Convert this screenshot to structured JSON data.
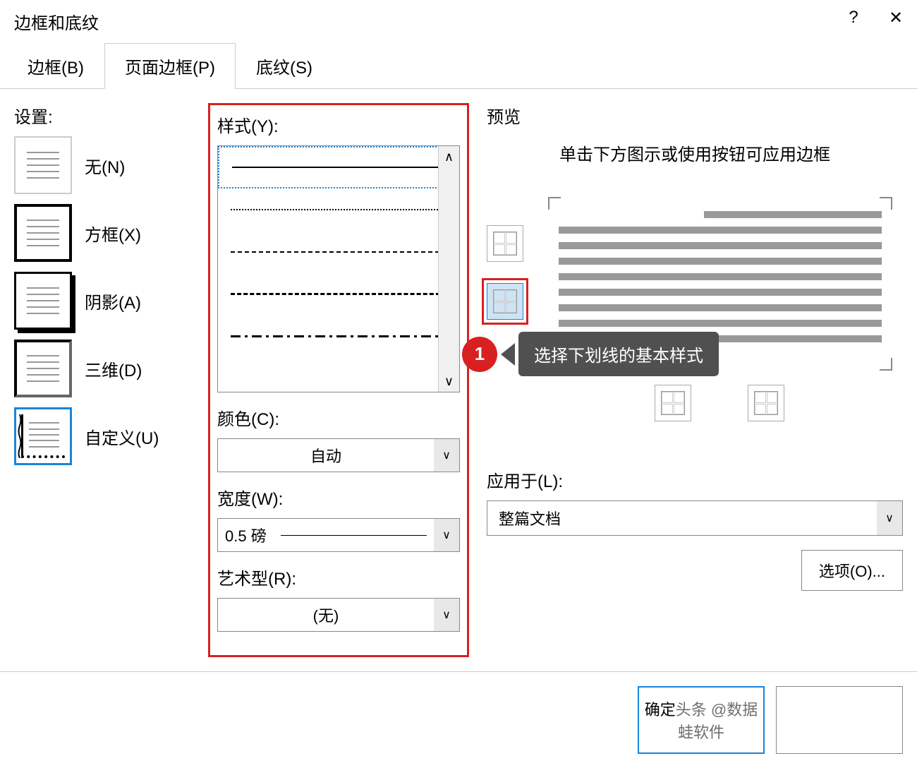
{
  "dialog": {
    "title": "边框和底纹",
    "help": "?",
    "close": "✕"
  },
  "tabs": {
    "border": "边框(B)",
    "page_border": "页面边框(P)",
    "shading": "底纹(S)"
  },
  "settings": {
    "label": "设置:",
    "none": "无(N)",
    "box": "方框(X)",
    "shadow": "阴影(A)",
    "three_d": "三维(D)",
    "custom": "自定义(U)"
  },
  "style": {
    "label": "样式(Y):",
    "color_label": "颜色(C):",
    "color_value": "自动",
    "width_label": "宽度(W):",
    "width_value": "0.5 磅",
    "art_label": "艺术型(R):",
    "art_value": "(无)"
  },
  "preview": {
    "label": "预览",
    "hint": "单击下方图示或使用按钮可应用边框",
    "apply_label": "应用于(L):",
    "apply_value": "整篇文档",
    "options_btn": "选项(O)..."
  },
  "callout": {
    "num": "1",
    "text": "选择下划线的基本样式"
  },
  "buttons": {
    "ok_prefix": "确定",
    "watermark": "头条 @数据蛙软件"
  }
}
